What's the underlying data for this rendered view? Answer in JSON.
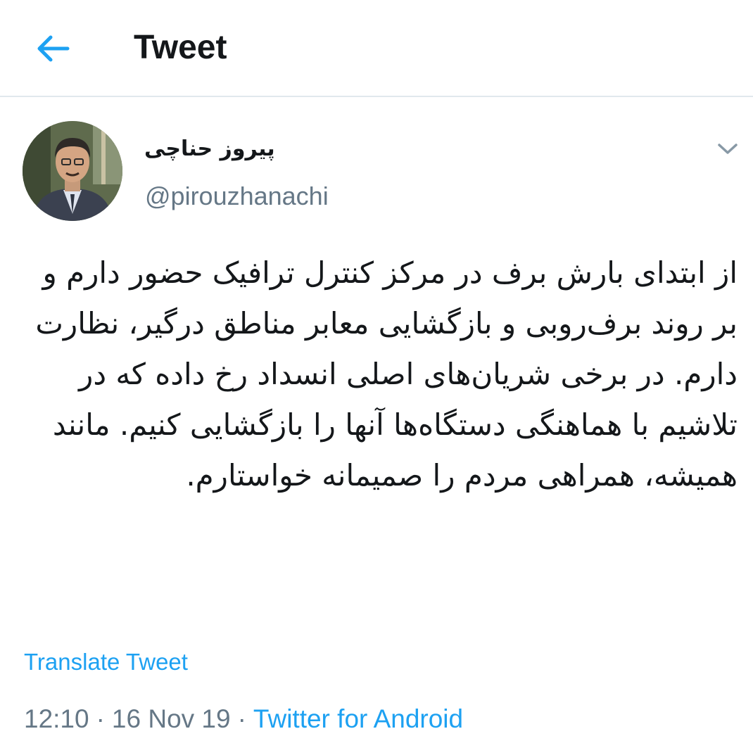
{
  "header": {
    "title": "Tweet",
    "back_icon": "arrow-left-icon"
  },
  "tweet": {
    "display_name": "پیروز حناچی",
    "handle": "@pirouzhanachi",
    "caret_icon": "chevron-down-icon",
    "text": "از ابتدای بارش برف در مرکز کنترل ترافیک حضور دارم و بر روند برف‌روبی و بازگشایی معابر مناطق درگیر، نظارت دارم. در برخی شریان‌های اصلی انسداد رخ داده که در تلاشیم با هماهنگی دستگاه‌ها آنها را بازگشایی کنیم. مانند همیشه، همراهی مردم را صمیمانه خواستارم.",
    "translate_label": "Translate Tweet",
    "time": "12:10",
    "date": "16 Nov 19",
    "separator": "·",
    "source": "Twitter for Android"
  },
  "colors": {
    "accent": "#1da1f2",
    "secondary_text": "#657786",
    "primary_text": "#14171a",
    "divider": "#e1e8ed"
  }
}
